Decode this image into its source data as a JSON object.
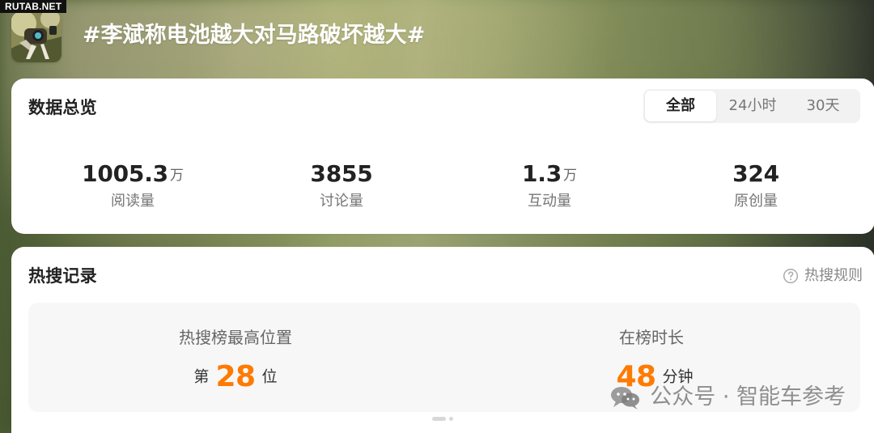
{
  "watermarks": {
    "top_left": "RUTAB.NET",
    "wechat": "公众号 · 智能车参考"
  },
  "header": {
    "avatar_icon": "car-camera-avatar-icon",
    "topic_title": "#李斌称电池越大对马路破坏越大#"
  },
  "overview": {
    "title": "数据总览",
    "time_filters": [
      "全部",
      "24小时",
      "30天"
    ],
    "selected_filter": "全部",
    "metrics": [
      {
        "value": "1005.3",
        "unit": "万",
        "label": "阅读量"
      },
      {
        "value": "3855",
        "unit": "",
        "label": "讨论量"
      },
      {
        "value": "1.3",
        "unit": "万",
        "label": "互动量"
      },
      {
        "value": "324",
        "unit": "",
        "label": "原创量"
      }
    ]
  },
  "hot_search": {
    "title": "热搜记录",
    "rules_label": "热搜规则",
    "rules_icon": "help-circle-icon",
    "highest_rank": {
      "label": "热搜榜最高位置",
      "prefix": "第",
      "value": "28",
      "suffix": "位"
    },
    "duration": {
      "label": "在榜时长",
      "value": "48",
      "suffix": "分钟"
    }
  },
  "colors": {
    "accent_orange": "#ff7a00",
    "card_background": "#ffffff",
    "panel_background": "#f7f7f7",
    "title_text": "#222222",
    "muted_text": "#777777"
  }
}
